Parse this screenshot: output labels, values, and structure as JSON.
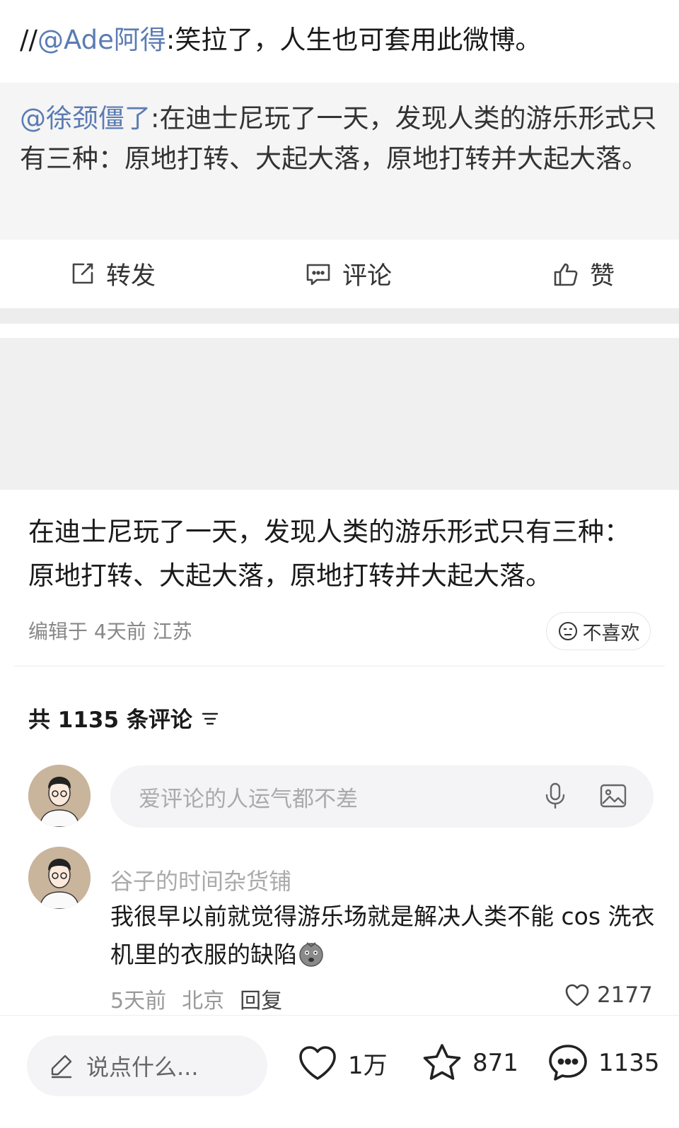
{
  "repost": {
    "prefix": "//",
    "mention": "@Ade阿得",
    "text": ":笑拉了，人生也可套用此微博。"
  },
  "original_post": {
    "mention": "@徐颈僵了",
    "text": ":在迪士尼玩了一天，发现人类的游乐形式只有三种：原地打转、大起大落，原地打转并大起大落。"
  },
  "actions": {
    "repost_label": "转发",
    "comment_label": "评论",
    "like_label": "赞"
  },
  "post": {
    "text": "在迪士尼玩了一天，发现人类的游乐形式只有三种：原地打转、大起大落，原地打转并大起大落。",
    "meta": "编辑于 4天前 江苏",
    "dislike_label": "不喜欢"
  },
  "comments_section": {
    "header": "共 1135 条评论",
    "input_placeholder": "爱评论的人运气都不差"
  },
  "comment": {
    "author": "谷子的时间杂货铺",
    "text": "我很早以前就觉得游乐场就是解决人类不能 cos 洗衣机里的衣服的缺陷",
    "time": "5天前",
    "location": "北京",
    "reply_label": "回复",
    "likes": "2177"
  },
  "bottom_bar": {
    "say_placeholder": "说点什么...",
    "likes": "1万",
    "favorites": "871",
    "comments": "1135"
  }
}
